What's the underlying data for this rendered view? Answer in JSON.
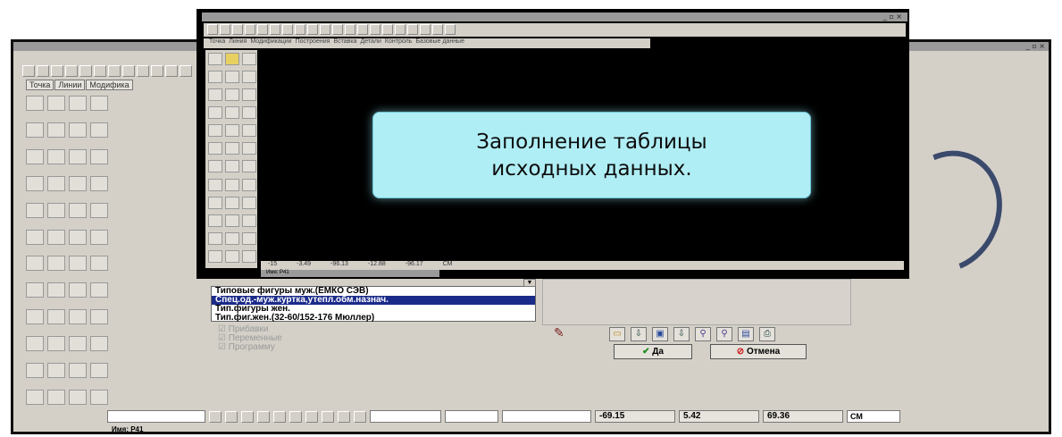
{
  "caption": {
    "text": "Заполнение таблицы\nисходных данных."
  },
  "background_window": {
    "tabs": [
      "Точка",
      "Линии",
      "Модифика"
    ]
  },
  "dialog": {
    "list_items": [
      "Типовые фигуры муж.(ЕМКО СЭВ)",
      "Спец.од.-муж.куртка,утепл.обм.назнач.",
      "Тип.фигуры жен.",
      "Тип.фиг.жен.(32-60/152-176 Мюллер)"
    ],
    "checkboxes": [
      "Прибавки",
      "Переменные",
      "Программу"
    ],
    "yes_label": "Да",
    "cancel_label": "Отмена"
  },
  "bottom_bar": {
    "x_value": "-69.15",
    "y_value": "5.42",
    "z_value": "69.36",
    "unit": "СМ",
    "status": "Имя: P41"
  },
  "overlay_window": {
    "tabs": [
      "Точка",
      "Линия",
      "Модификации",
      "Построения",
      "Вставка",
      "Детали",
      "Контроль",
      "Базовые данные"
    ],
    "bottom_values": [
      "-15",
      "-3.49",
      "-96.13",
      "-12.88",
      "-96.17",
      "СМ"
    ],
    "status": "Имя: P41"
  },
  "colors": {
    "caption_bg": "#b0eef5",
    "selection": "#1b2b8a"
  }
}
